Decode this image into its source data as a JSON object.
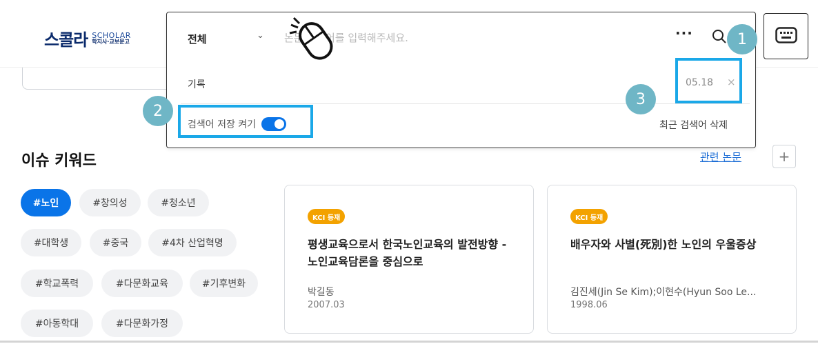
{
  "logo": {
    "main": "스콜라",
    "sub_en": "SCHOLAR",
    "sub_ko": "학지사·교보문고"
  },
  "search": {
    "scope": "전체",
    "placeholder": "논문 검색어를 입력해주세요.",
    "more": "···",
    "history_label": "기록",
    "history_item_date": "05.18",
    "history_close": "×",
    "save_label": "검색어 저장 켜기",
    "save_enabled": true,
    "delete_recent": "최근 검색어 삭제"
  },
  "callouts": [
    "1",
    "2",
    "3"
  ],
  "keywords": {
    "title": "이슈 키워드",
    "related_link": "관련 논문",
    "add": "+",
    "chips": [
      "#노인",
      "#창의성",
      "#청소년",
      "#대학생",
      "#중국",
      "#4차 산업혁명",
      "#학교폭력",
      "#다문화교육",
      "#기후변화",
      "#아동학대",
      "#다문화가정"
    ]
  },
  "papers": [
    {
      "badge": "KCI 등재",
      "title": "평생교육으로서 한국노인교육의 발전방향 - 노인교육담론을 중심으로",
      "author": "박길동",
      "date": "2007.03"
    },
    {
      "badge": "KCI 등재",
      "title": "배우자와 사별(死別)한 노인의 우울증상",
      "author": "김진세(Jin Se Kim);이현수(Hyun Soo Le...",
      "date": "1998.06"
    }
  ],
  "colors": {
    "accent": "#0a74e8",
    "callout": "#6fb6c6",
    "highlight": "#1aa8e8",
    "kci": "#f3a200"
  },
  "icons": [
    "search-icon",
    "keyboard-icon",
    "mouse-cursor-icon",
    "chevron-down-icon",
    "close-icon",
    "plus-icon"
  ]
}
